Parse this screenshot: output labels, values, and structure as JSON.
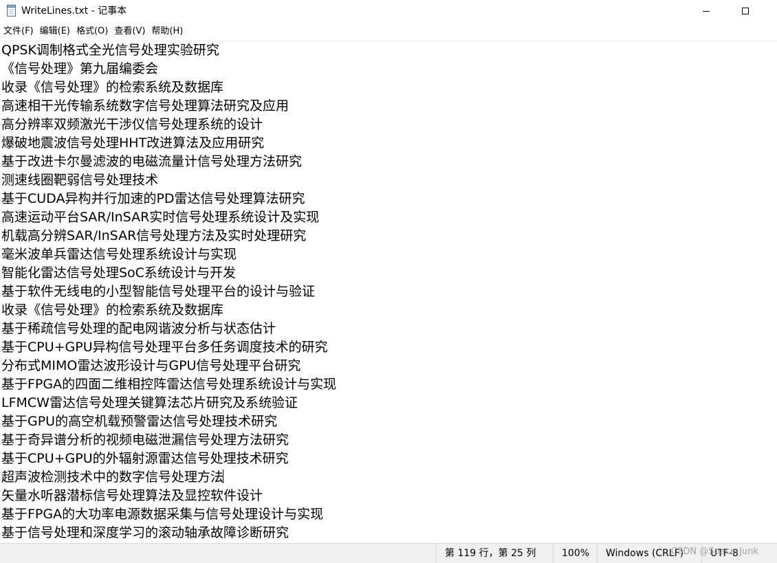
{
  "window": {
    "title": "WriteLines.txt - 记事本",
    "icon": "notepad-icon"
  },
  "menu": [
    {
      "label": "文件(F)"
    },
    {
      "label": "编辑(E)"
    },
    {
      "label": "格式(O)"
    },
    {
      "label": "查看(V)"
    },
    {
      "label": "帮助(H)"
    }
  ],
  "editor": {
    "lines": [
      "QPSK调制格式全光信号处理实验研究",
      "《信号处理》第九届编委会",
      "收录《信号处理》的检索系统及数据库",
      "高速相干光传输系统数字信号处理算法研究及应用",
      "高分辨率双频激光干涉仪信号处理系统的设计",
      "爆破地震波信号处理HHT改进算法及应用研究",
      "基于改进卡尔曼滤波的电磁流量计信号处理方法研究",
      "测速线圈靶弱信号处理技术",
      "基于CUDA异构并行加速的PD雷达信号处理算法研究",
      "高速运动平台SAR/InSAR实时信号处理系统设计及实现",
      "机载高分辨SAR/InSAR信号处理方法及实时处理研究",
      "毫米波单兵雷达信号处理系统设计与实现",
      "智能化雷达信号处理SoC系统设计与开发",
      "基于软件无线电的小型智能信号处理平台的设计与验证",
      "收录《信号处理》的检索系统及数据库",
      "基于稀疏信号处理的配电网谐波分析与状态估计",
      "基于CPU+GPU异构信号处理平台多任务调度技术的研究",
      "分布式MIMO雷达波形设计与GPU信号处理平台研究",
      "基于FPGA的四面二维相控阵雷达信号处理系统设计与实现",
      "LFMCW雷达信号处理关键算法芯片研究及系统验证",
      "基于GPU的高空机载预警雷达信号处理技术研究",
      "基于奇异谱分析的视频电磁泄漏信号处理方法研究",
      "基于CPU+GPU的外辐射源雷达信号处理技术研究",
      "超声波检测技术中的数字信号处理方法",
      "矢量水听器潜标信号处理算法及显控软件设计",
      "基于FPGA的大功率电源数据采集与信号处理设计与实现",
      "基于信号处理和深度学习的滚动轴承故障诊断研究"
    ],
    "caret_line": 23
  },
  "status": {
    "position": "第 119 行，第 25 列",
    "zoom": "100%",
    "line_ending": "Windows (CRLF)",
    "encoding": "UTF-8"
  },
  "watermark": "CSDN @Space-Junk"
}
